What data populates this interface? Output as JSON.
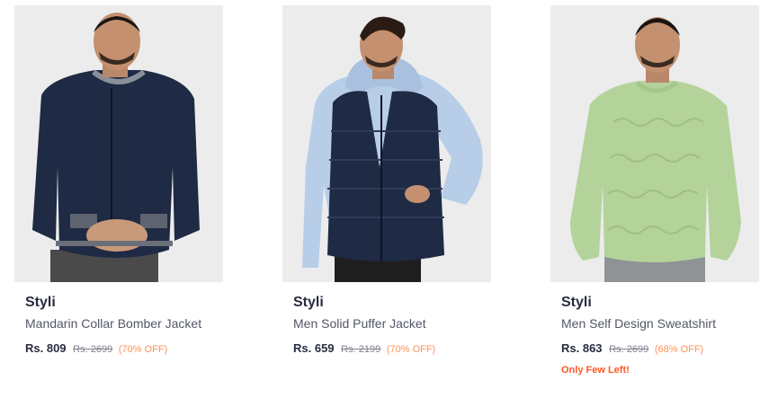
{
  "products": [
    {
      "image": "man-in-navy-bomber-jacket",
      "brand": "Styli",
      "name": "Mandarin Collar Bomber Jacket",
      "price": "Rs. 809",
      "mrp": "Rs. 2699",
      "discount": "(70% OFF)"
    },
    {
      "image": "man-in-navy-puffer-vest-over-light-blue-hoodie",
      "brand": "Styli",
      "name": "Men Solid Puffer Jacket",
      "price": "Rs. 659",
      "mrp": "Rs. 2199",
      "discount": "(70% OFF)"
    },
    {
      "image": "man-in-green-textured-sweatshirt",
      "brand": "Styli",
      "name": "Men Self Design Sweatshirt",
      "price": "Rs. 863",
      "mrp": "Rs. 2699",
      "discount": "(68% OFF)",
      "stock_note": "Only Few Left!"
    }
  ],
  "colors": {
    "discount": "#ff905a",
    "stock_note": "#ff5722",
    "image_bg": "#ededed"
  }
}
